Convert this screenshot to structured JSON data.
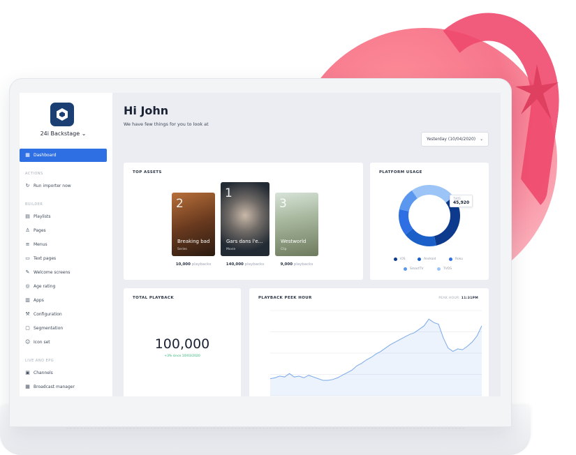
{
  "colors": {
    "accent": "#2f6fe4",
    "logo_bg": "#1b3f73",
    "positive": "#2bb673",
    "decor_pink": "#f56f86",
    "star": "#e0405f"
  },
  "app": {
    "brand_name": "24i Backstage",
    "logo_icon": "hexagon-icon"
  },
  "sidebar": {
    "active_item": {
      "label": "Dashboard",
      "icon": "grid-icon"
    },
    "sections": [
      {
        "heading": "ACTIONS",
        "items": [
          {
            "label": "Run importer now",
            "icon": "refresh-icon"
          }
        ]
      },
      {
        "heading": "BUILDER",
        "items": [
          {
            "label": "Playlists",
            "icon": "playlist-icon"
          },
          {
            "label": "Pages",
            "icon": "pages-icon"
          },
          {
            "label": "Menus",
            "icon": "menu-icon"
          },
          {
            "label": "Text pages",
            "icon": "text-page-icon"
          },
          {
            "label": "Welcome screens",
            "icon": "welcome-icon"
          },
          {
            "label": "Age rating",
            "icon": "age-rating-icon"
          },
          {
            "label": "Apps",
            "icon": "apps-icon"
          },
          {
            "label": "Configuration",
            "icon": "wrench-icon"
          },
          {
            "label": "Segmentation",
            "icon": "segment-icon"
          },
          {
            "label": "Icon set",
            "icon": "icon-set-icon"
          }
        ]
      },
      {
        "heading": "LIVE AND EPG",
        "items": [
          {
            "label": "Channels",
            "icon": "channels-icon"
          },
          {
            "label": "Broadcast manager",
            "icon": "calendar-icon"
          }
        ]
      }
    ]
  },
  "header": {
    "greeting": "Hi John",
    "subtitle": "We have few things for you to look at",
    "date_filter": "Yesterday (10/04/2020)"
  },
  "top_assets": {
    "title": "TOP ASSETS",
    "unit_label": "playbacks",
    "items": [
      {
        "rank": "2",
        "title": "Breaking bad",
        "type": "Series",
        "playbacks": "10,000"
      },
      {
        "rank": "1",
        "title": "Gars dans l'e...",
        "type": "Movie",
        "playbacks": "140,000"
      },
      {
        "rank": "3",
        "title": "Westworld",
        "type": "Clip",
        "playbacks": "9,000"
      }
    ]
  },
  "platform_usage": {
    "title": "PLATFORM USAGE",
    "tooltip": {
      "label": "TVOS",
      "value": "45,920"
    },
    "legend": [
      {
        "name": "iOS",
        "color": "#0d3a8c"
      },
      {
        "name": "Android",
        "color": "#1b5fc9"
      },
      {
        "name": "Roku",
        "color": "#2f6fe4"
      },
      {
        "name": "SmartTV",
        "color": "#5b97ee"
      },
      {
        "name": "TVOS",
        "color": "#9cc4f7"
      }
    ]
  },
  "total_playback": {
    "title": "TOTAL PLAYBACK",
    "value": "100,000",
    "delta": "+3% since 10/03/2020"
  },
  "peak_hour": {
    "title": "PLAYBACK PEEK HOUR",
    "label": "PEAK HOUR:",
    "value": "11:31PM"
  },
  "chart_data": [
    {
      "type": "pie",
      "title": "PLATFORM USAGE",
      "categories": [
        "iOS",
        "Android",
        "Roku",
        "SmartTV",
        "TVOS"
      ],
      "values": [
        32,
        18,
        14,
        12,
        24
      ],
      "style": "donut"
    },
    {
      "type": "line",
      "title": "PLAYBACK PEEK HOUR",
      "series": [
        {
          "values": [
            20,
            21,
            23,
            22,
            26,
            22,
            23,
            21,
            24,
            22,
            20,
            18,
            18,
            19,
            21,
            24,
            27,
            30,
            35,
            38,
            42,
            45,
            49,
            52,
            56,
            60,
            63,
            66,
            69,
            72,
            74,
            78,
            82,
            90,
            86,
            84,
            68,
            56,
            52,
            55,
            54,
            58,
            63,
            70,
            82
          ]
        }
      ],
      "ylim": [
        0,
        100
      ]
    }
  ]
}
